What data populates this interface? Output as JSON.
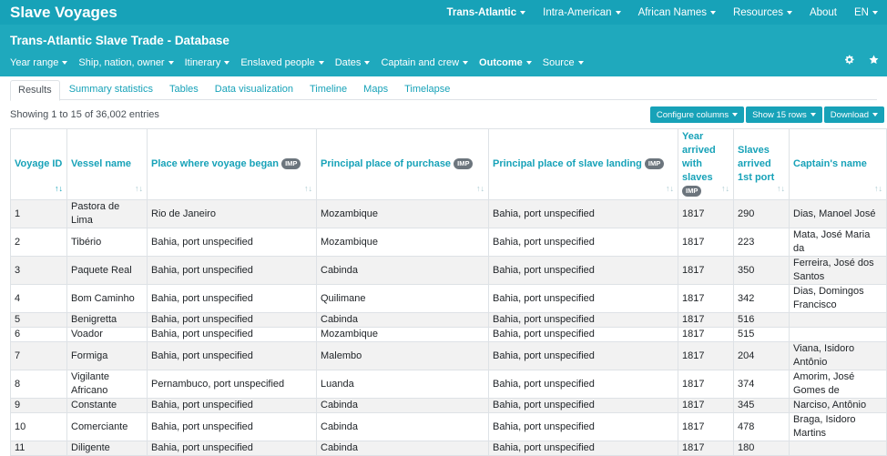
{
  "app": {
    "brand": "Slave Voyages",
    "top_nav": [
      {
        "label": "Trans-Atlantic",
        "active": true,
        "dropdown": true
      },
      {
        "label": "Intra-American",
        "active": false,
        "dropdown": true
      },
      {
        "label": "African Names",
        "active": false,
        "dropdown": true
      },
      {
        "label": "Resources",
        "active": false,
        "dropdown": true
      },
      {
        "label": "About",
        "active": false,
        "dropdown": false
      },
      {
        "label": "EN",
        "active": false,
        "dropdown": true
      }
    ]
  },
  "subheader": {
    "title": "Trans-Atlantic Slave Trade - Database",
    "filters": [
      {
        "label": "Year range",
        "active": false
      },
      {
        "label": "Ship, nation, owner",
        "active": false
      },
      {
        "label": "Itinerary",
        "active": false
      },
      {
        "label": "Enslaved people",
        "active": false
      },
      {
        "label": "Dates",
        "active": false
      },
      {
        "label": "Captain and crew",
        "active": false
      },
      {
        "label": "Outcome",
        "active": true
      },
      {
        "label": "Source",
        "active": false
      }
    ],
    "icons": [
      "gear-icon",
      "star-icon"
    ]
  },
  "tabs": [
    {
      "label": "Results",
      "active": true
    },
    {
      "label": "Summary statistics",
      "active": false
    },
    {
      "label": "Tables",
      "active": false
    },
    {
      "label": "Data visualization",
      "active": false
    },
    {
      "label": "Timeline",
      "active": false
    },
    {
      "label": "Maps",
      "active": false
    },
    {
      "label": "Timelapse",
      "active": false
    }
  ],
  "table_info": {
    "entries_text": "Showing 1 to 15 of 36,002 entries",
    "buttons": {
      "configure": "Configure columns",
      "rows": "Show 15 rows",
      "download": "Download"
    }
  },
  "table": {
    "imp_badge": "IMP",
    "columns": [
      {
        "key": "id",
        "label": "Voyage ID",
        "imp": false,
        "sorted": true
      },
      {
        "key": "vessel",
        "label": "Vessel name",
        "imp": false,
        "sorted": false
      },
      {
        "key": "began",
        "label": "Place where voyage began",
        "imp": true,
        "sorted": false
      },
      {
        "key": "purchase",
        "label": "Principal place of purchase",
        "imp": true,
        "sorted": false
      },
      {
        "key": "landing",
        "label": "Principal place of slave landing",
        "imp": true,
        "sorted": false
      },
      {
        "key": "year",
        "label": "Year arrived with slaves",
        "imp": true,
        "sorted": false
      },
      {
        "key": "slaves",
        "label": "Slaves arrived 1st port",
        "imp": false,
        "sorted": false
      },
      {
        "key": "captain",
        "label": "Captain's name",
        "imp": false,
        "sorted": false
      }
    ],
    "rows": [
      {
        "id": "1",
        "vessel": "Pastora de Lima",
        "began": "Rio de Janeiro",
        "purchase": "Mozambique",
        "landing": "Bahia, port unspecified",
        "year": "1817",
        "slaves": "290",
        "captain": "Dias, Manoel José"
      },
      {
        "id": "2",
        "vessel": "Tibério",
        "began": "Bahia, port unspecified",
        "purchase": "Mozambique",
        "landing": "Bahia, port unspecified",
        "year": "1817",
        "slaves": "223",
        "captain": "Mata, José Maria da"
      },
      {
        "id": "3",
        "vessel": "Paquete Real",
        "began": "Bahia, port unspecified",
        "purchase": "Cabinda",
        "landing": "Bahia, port unspecified",
        "year": "1817",
        "slaves": "350",
        "captain": "Ferreira, José dos Santos"
      },
      {
        "id": "4",
        "vessel": "Bom Caminho",
        "began": "Bahia, port unspecified",
        "purchase": "Quilimane",
        "landing": "Bahia, port unspecified",
        "year": "1817",
        "slaves": "342",
        "captain": "Dias, Domingos Francisco"
      },
      {
        "id": "5",
        "vessel": "Benigretta",
        "began": "Bahia, port unspecified",
        "purchase": "Cabinda",
        "landing": "Bahia, port unspecified",
        "year": "1817",
        "slaves": "516",
        "captain": ""
      },
      {
        "id": "6",
        "vessel": "Voador",
        "began": "Bahia, port unspecified",
        "purchase": "Mozambique",
        "landing": "Bahia, port unspecified",
        "year": "1817",
        "slaves": "515",
        "captain": ""
      },
      {
        "id": "7",
        "vessel": "Formiga",
        "began": "Bahia, port unspecified",
        "purchase": "Malembo",
        "landing": "Bahia, port unspecified",
        "year": "1817",
        "slaves": "204",
        "captain": "Viana, Isidoro Antônio"
      },
      {
        "id": "8",
        "vessel": "Vigilante Africano",
        "began": "Pernambuco, port unspecified",
        "purchase": "Luanda",
        "landing": "Bahia, port unspecified",
        "year": "1817",
        "slaves": "374",
        "captain": "Amorim, José Gomes de"
      },
      {
        "id": "9",
        "vessel": "Constante",
        "began": "Bahia, port unspecified",
        "purchase": "Cabinda",
        "landing": "Bahia, port unspecified",
        "year": "1817",
        "slaves": "345",
        "captain": "Narciso, Antônio"
      },
      {
        "id": "10",
        "vessel": "Comerciante",
        "began": "Bahia, port unspecified",
        "purchase": "Cabinda",
        "landing": "Bahia, port unspecified",
        "year": "1817",
        "slaves": "478",
        "captain": "Braga, Isidoro Martins"
      },
      {
        "id": "11",
        "vessel": "Diligente",
        "began": "Bahia, port unspecified",
        "purchase": "Cabinda",
        "landing": "Bahia, port unspecified",
        "year": "1817",
        "slaves": "180",
        "captain": ""
      }
    ]
  },
  "colors": {
    "accent": "#17a2b8",
    "subheader": "#1fa9bd",
    "stripe": "#f2f2f2",
    "badge": "#6c757d"
  }
}
